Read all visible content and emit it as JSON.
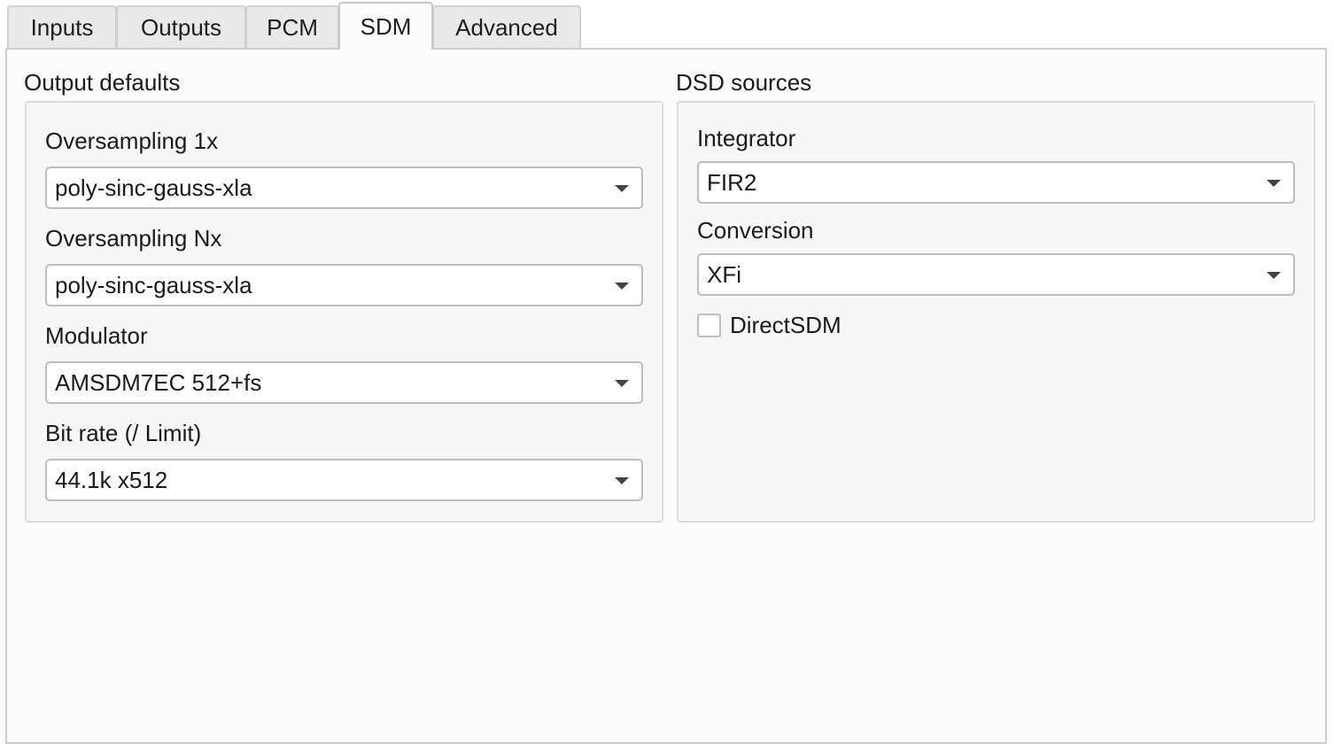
{
  "tabs": [
    {
      "label": "Inputs",
      "active": false
    },
    {
      "label": "Outputs",
      "active": false
    },
    {
      "label": "PCM",
      "active": false
    },
    {
      "label": "SDM",
      "active": true
    },
    {
      "label": "Advanced",
      "active": false
    }
  ],
  "output_defaults": {
    "title": "Output defaults",
    "oversampling_1x": {
      "label": "Oversampling 1x",
      "value": "poly-sinc-gauss-xla"
    },
    "oversampling_nx": {
      "label": "Oversampling Nx",
      "value": "poly-sinc-gauss-xla"
    },
    "modulator": {
      "label": "Modulator",
      "value": "AMSDM7EC 512+fs"
    },
    "bit_rate": {
      "label": "Bit rate (/ Limit)",
      "value": "44.1k x512"
    }
  },
  "dsd_sources": {
    "title": "DSD sources",
    "integrator": {
      "label": "Integrator",
      "value": "FIR2"
    },
    "conversion": {
      "label": "Conversion",
      "value": "XFi"
    },
    "direct_sdm": {
      "label": "DirectSDM",
      "checked": false
    }
  },
  "icons": {
    "dropdown": "chevron-down-icon"
  }
}
